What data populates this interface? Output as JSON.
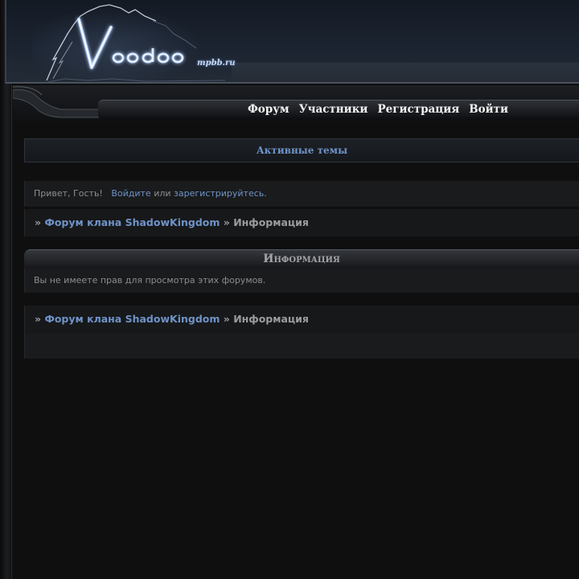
{
  "header": {
    "logo_text": "Voodoo",
    "logo_sub": "mpbb.ru",
    "icon": "voodoo-logo-icon"
  },
  "nav": {
    "items": [
      {
        "label": "Форум"
      },
      {
        "label": "Участники"
      },
      {
        "label": "Регистрация"
      },
      {
        "label": "Войти"
      }
    ]
  },
  "active_topics": {
    "label": "Активные темы"
  },
  "greeting": {
    "prefix": "Привет, Гость!",
    "login_link": "Войдите",
    "or_text": "или",
    "register_link": "зарегистрируйтесь",
    "suffix": "."
  },
  "breadcrumb": {
    "separator": "»",
    "forum_link": "Форум клана ShadowKingdom",
    "current": "Информация"
  },
  "info": {
    "title": "Информация",
    "message": "Вы не имеете прав для просмотра этих форумов."
  },
  "colors": {
    "link": "#6f93c7",
    "text": "#8b8d90",
    "background": "#0f0f10"
  }
}
